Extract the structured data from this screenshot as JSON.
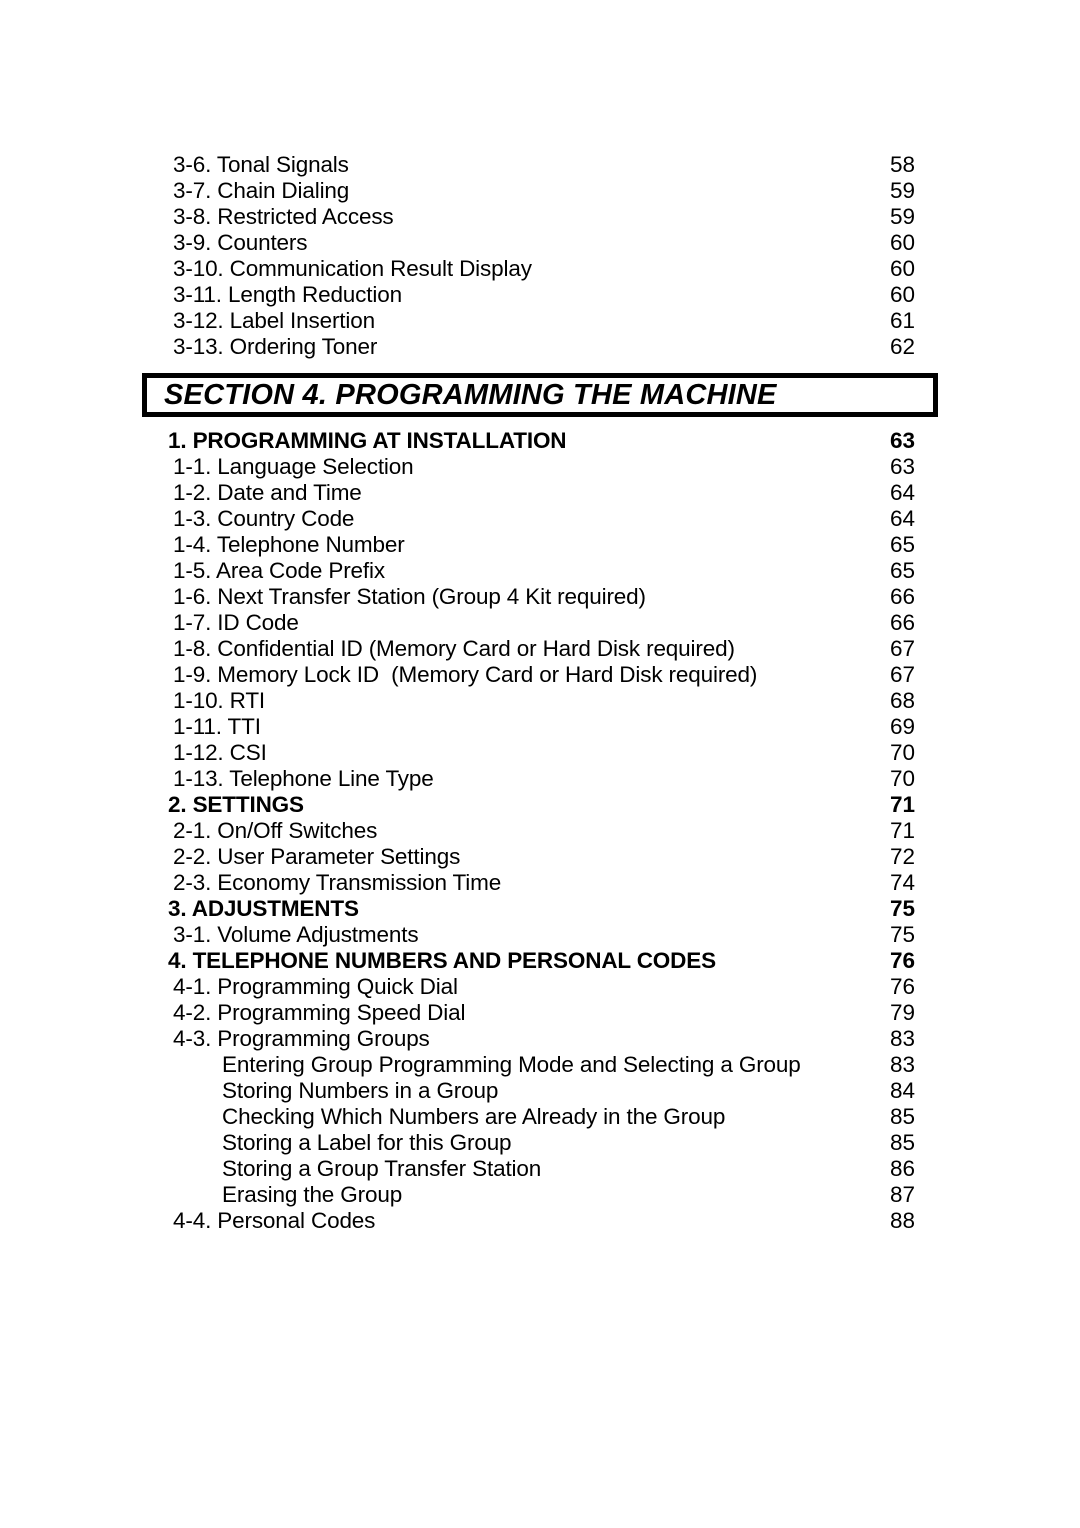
{
  "document": {
    "kind": "table-of-contents-page"
  },
  "toc_top": {
    "entries": [
      {
        "level": "sub",
        "title": "3-6. Tonal Signals",
        "page": "58"
      },
      {
        "level": "sub",
        "title": "3-7. Chain Dialing",
        "page": "59"
      },
      {
        "level": "sub",
        "title": "3-8. Restricted Access",
        "page": "59"
      },
      {
        "level": "sub",
        "title": "3-9. Counters",
        "page": "60"
      },
      {
        "level": "sub",
        "title": "3-10. Communication Result Display",
        "page": "60"
      },
      {
        "level": "sub",
        "title": "3-11. Length Reduction",
        "page": "60"
      },
      {
        "level": "sub",
        "title": "3-12. Label Insertion",
        "page": "61"
      },
      {
        "level": "sub",
        "title": "3-13. Ordering Toner",
        "page": "62"
      }
    ]
  },
  "section_banner": {
    "label": "SECTION 4. PROGRAMMING THE MACHINE"
  },
  "toc_main": {
    "entries": [
      {
        "level": "heading",
        "title": "1. PROGRAMMING AT INSTALLATION",
        "page": "63"
      },
      {
        "level": "sub",
        "title": "1-1. Language Selection",
        "page": "63"
      },
      {
        "level": "sub",
        "title": "1-2. Date and Time",
        "page": "64"
      },
      {
        "level": "sub",
        "title": "1-3. Country Code",
        "page": "64"
      },
      {
        "level": "sub",
        "title": "1-4. Telephone Number",
        "page": "65"
      },
      {
        "level": "sub",
        "title": "1-5. Area Code Prefix",
        "page": "65"
      },
      {
        "level": "sub",
        "title": "1-6. Next Transfer Station (Group 4 Kit required)",
        "page": "66"
      },
      {
        "level": "sub",
        "title": "1-7. ID Code",
        "page": "66"
      },
      {
        "level": "sub",
        "title": "1-8. Confidential ID (Memory Card or Hard Disk required)",
        "page": "67"
      },
      {
        "level": "sub",
        "title": "1-9. Memory Lock ID  (Memory Card or Hard Disk required)",
        "page": "67"
      },
      {
        "level": "sub",
        "title": "1-10. RTI",
        "page": "68"
      },
      {
        "level": "sub",
        "title": "1-11. TTI",
        "page": "69"
      },
      {
        "level": "sub",
        "title": "1-12. CSI",
        "page": "70"
      },
      {
        "level": "sub",
        "title": "1-13. Telephone Line Type",
        "page": "70"
      },
      {
        "level": "heading",
        "title": "2. SETTINGS",
        "page": "71"
      },
      {
        "level": "sub",
        "title": "2-1. On/Off Switches",
        "page": "71"
      },
      {
        "level": "sub",
        "title": "2-2. User Parameter Settings",
        "page": "72"
      },
      {
        "level": "sub",
        "title": "2-3. Economy Transmission Time",
        "page": "74"
      },
      {
        "level": "heading",
        "title": "3. ADJUSTMENTS",
        "page": "75"
      },
      {
        "level": "sub",
        "title": "3-1. Volume Adjustments",
        "page": "75"
      },
      {
        "level": "heading",
        "title": "4. TELEPHONE NUMBERS AND PERSONAL CODES",
        "page": "76"
      },
      {
        "level": "sub",
        "title": "4-1. Programming Quick Dial",
        "page": "76"
      },
      {
        "level": "sub",
        "title": "4-2. Programming Speed Dial",
        "page": "79"
      },
      {
        "level": "sub",
        "title": "4-3. Programming Groups",
        "page": "83"
      },
      {
        "level": "subsub",
        "title": "Entering Group Programming Mode and Selecting a Group",
        "page": "83"
      },
      {
        "level": "subsub",
        "title": "Storing Numbers in a Group",
        "page": "84"
      },
      {
        "level": "subsub",
        "title": "Checking Which Numbers are Already in the Group",
        "page": "85"
      },
      {
        "level": "subsub",
        "title": "Storing a Label for this Group",
        "page": "85"
      },
      {
        "level": "subsub",
        "title": "Storing a Group Transfer Station",
        "page": "86"
      },
      {
        "level": "subsub",
        "title": "Erasing the Group",
        "page": "87"
      },
      {
        "level": "sub",
        "title": "4-4. Personal Codes",
        "page": "88"
      }
    ]
  }
}
